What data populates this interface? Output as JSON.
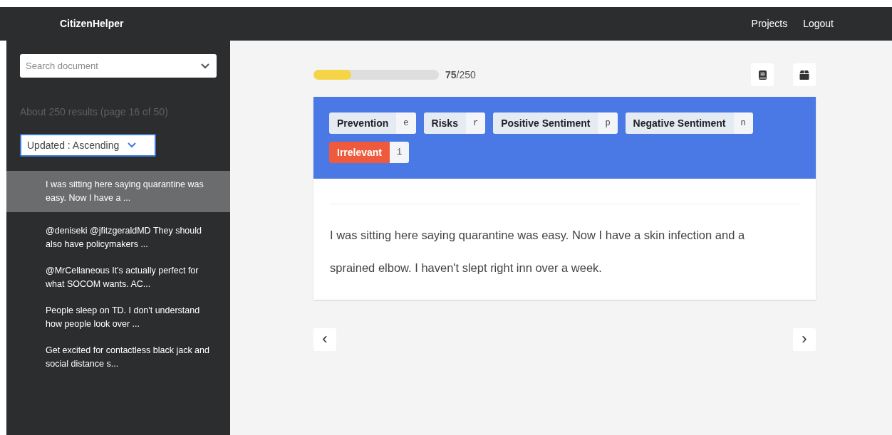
{
  "navbar": {
    "brand": "CitizenHelper",
    "links": [
      "Projects",
      "Logout"
    ]
  },
  "sidebar": {
    "search": {
      "placeholder": "Search document"
    },
    "results_info": "About 250 results (page 16 of 50)",
    "sort": {
      "value": "Updated : Ascending"
    },
    "items": [
      {
        "text": "I was sitting here saying quarantine was easy. Now I have a ...",
        "selected": true
      },
      {
        "text": "@deniseki @jfitzgeraldMD They should also have policymakers ...",
        "selected": false
      },
      {
        "text": "@MrCellaneous It's actually perfect for what SOCOM wants. AC...",
        "selected": false
      },
      {
        "text": "People sleep on TD. I don't understand how people look over ...",
        "selected": false
      },
      {
        "text": "Get excited for contactless black jack and social distance s...",
        "selected": false
      }
    ]
  },
  "progress": {
    "level": 0.3,
    "text": "**75**/250"
  },
  "labels": [
    {
      "name": "Prevention",
      "key": "e",
      "selected": false
    },
    {
      "name": "Risks",
      "key": "r",
      "selected": false
    },
    {
      "name": "Positive Sentiment",
      "key": "p",
      "selected": false
    },
    {
      "name": "Negative Sentiment",
      "key": "n",
      "selected": false
    },
    {
      "name": "Irrelevant",
      "key": "i",
      "selected": true
    }
  ],
  "document": {
    "text": "I was sitting here saying quarantine was easy. Now I have a skin infection and a sprained elbow. I haven't slept right inn over a week."
  },
  "nav_buttons": [
    "‹",
    "›"
  ]
}
